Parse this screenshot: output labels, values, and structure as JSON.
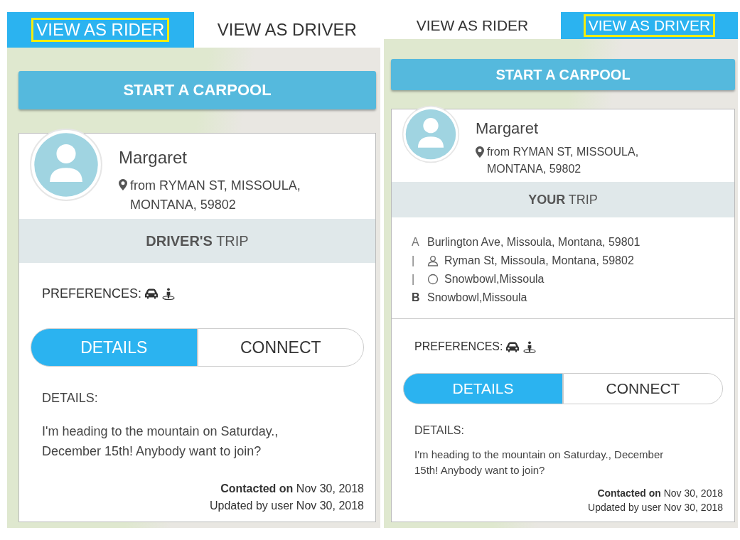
{
  "panels": [
    {
      "tabs": [
        {
          "label": "VIEW AS RIDER",
          "selected": true,
          "outlined": true
        },
        {
          "label": "VIEW AS DRIVER",
          "selected": false,
          "outlined": false
        }
      ],
      "start_button": "START A CARPOOL",
      "profile": {
        "name": "Margaret",
        "location": "from RYMAN ST, MISSOULA, MONTANA, 59802"
      },
      "trip_header": "**DRIVER'S** TRIP",
      "preferences_label": "PREFERENCES:",
      "segments": [
        {
          "label": "DETAILS",
          "selected": true
        },
        {
          "label": "CONNECT",
          "selected": false
        }
      ],
      "details_label": "DETAILS:",
      "details_text": "I'm heading to the mountain on Saturday., December 15th! Anybody want to join?",
      "contacted": "**Contacted on** Nov 30, 2018",
      "updated": "Updated by user Nov 30, 2018"
    },
    {
      "tabs": [
        {
          "label": "VIEW AS RIDER",
          "selected": false,
          "outlined": false
        },
        {
          "label": "VIEW AS DRIVER",
          "selected": true,
          "outlined": true
        }
      ],
      "start_button": "START A CARPOOL",
      "profile": {
        "name": "Margaret",
        "location": "from RYMAN ST, MISSOULA, MONTANA, 59802"
      },
      "trip_header": "**YOUR** TRIP",
      "route": [
        {
          "kind": "start",
          "marker": "A",
          "text": "Burlington Ave, Missoula, Montana, 59801"
        },
        {
          "kind": "rider",
          "marker": "|",
          "text": "Ryman St, Missoula, Montana, 59802"
        },
        {
          "kind": "waypoint",
          "marker": "|",
          "text": "Snowbowl,Missoula"
        },
        {
          "kind": "end",
          "marker": "B",
          "text": "Snowbowl,Missoula"
        }
      ],
      "preferences_label": "PREFERENCES:",
      "segments": [
        {
          "label": "DETAILS",
          "selected": true
        },
        {
          "label": "CONNECT",
          "selected": false
        }
      ],
      "details_label": "DETAILS:",
      "details_text": "I'm heading to the mountain on Saturday., December 15th! Anybody want to join?",
      "contacted": "**Contacted on** Nov 30, 2018",
      "updated": "Updated by user Nov 30, 2018"
    }
  ]
}
